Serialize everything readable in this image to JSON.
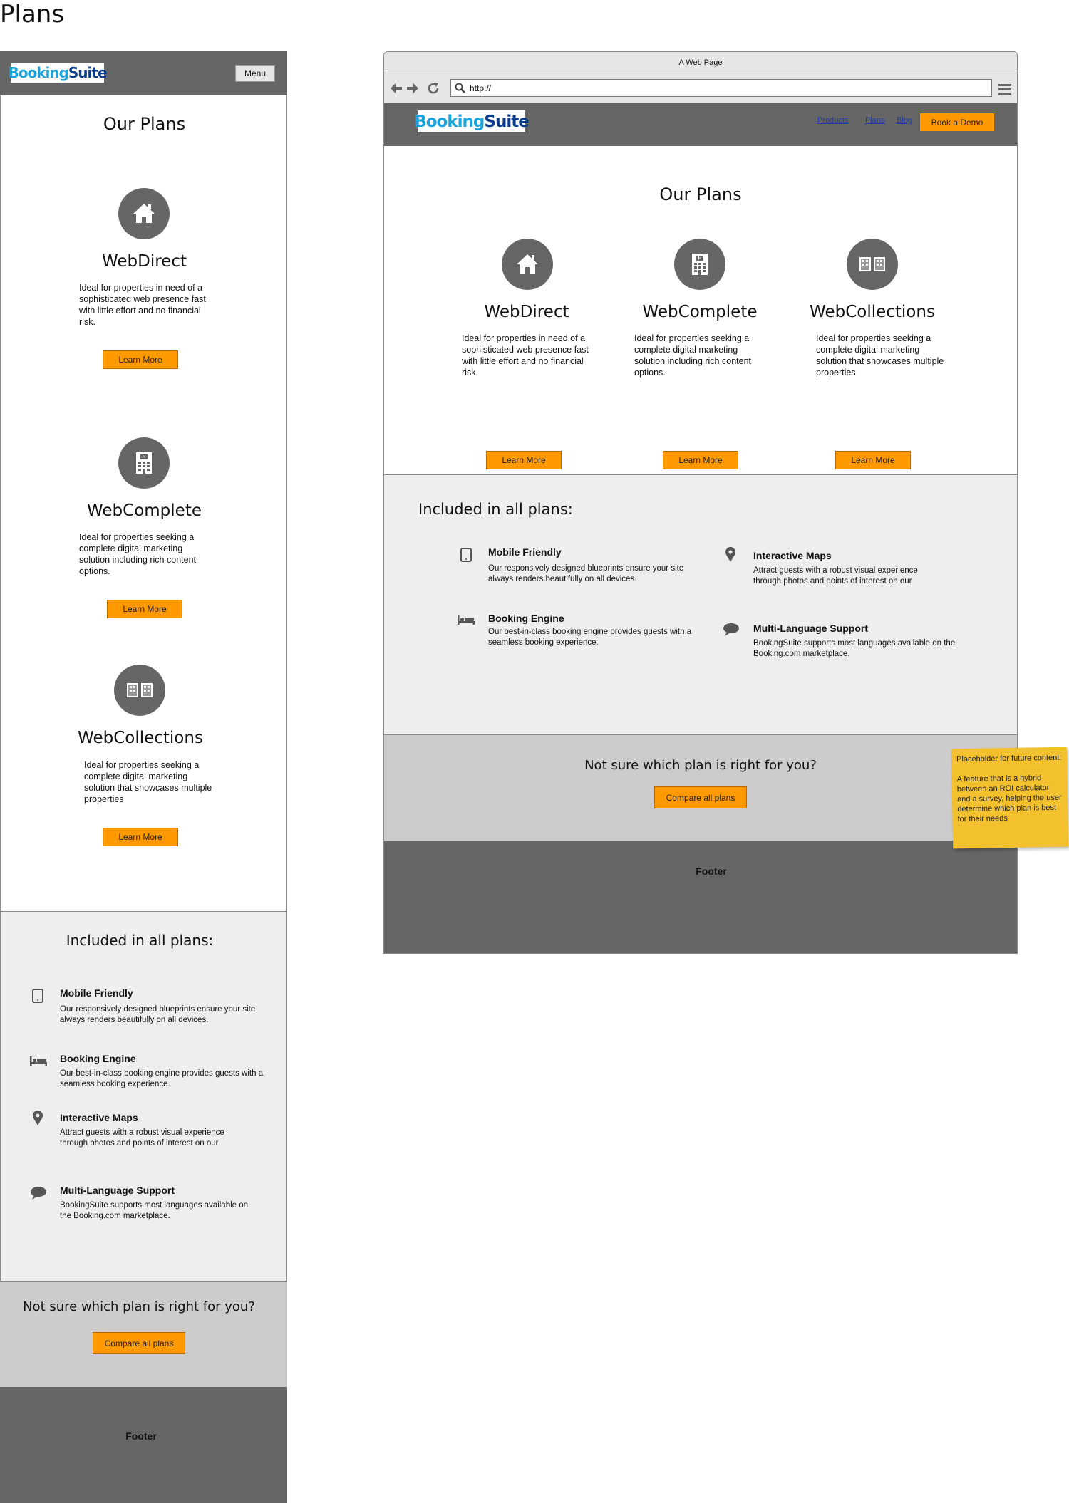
{
  "page": {
    "heading": "Plans"
  },
  "brand": {
    "part1": "Booking",
    "part2": "Suite"
  },
  "mobile": {
    "menu_label": "Menu"
  },
  "browser": {
    "title": "A Web Page",
    "url": "http://",
    "nav": [
      {
        "label": "Products"
      },
      {
        "label": "Plans"
      },
      {
        "label": "Blog"
      }
    ],
    "cta": "Book a Demo"
  },
  "plans_heading": "Our Plans",
  "plans": [
    {
      "title": "WebDirect",
      "desc": "Ideal for properties in need of a sophisticated web presence fast with little effort and no financial risk.",
      "button": "Learn More",
      "icon": "house-icon"
    },
    {
      "title": "WebComplete",
      "desc": "Ideal for properties seeking a complete digital marketing solution including rich content options.",
      "button": "Learn More",
      "icon": "hotel-building-icon"
    },
    {
      "title": "WebCollections",
      "desc": "Ideal for properties seeking a complete digital marketing solution that showcases multiple properties",
      "button": "Learn More",
      "icon": "buildings-icon"
    }
  ],
  "included_heading": "Included in all plans:",
  "features": [
    {
      "title": "Mobile Friendly",
      "desc": "Our responsively designed blueprints ensure your site always renders beautifully on all devices.",
      "icon": "tablet-icon"
    },
    {
      "title": "Booking Engine",
      "desc": "Our best-in-class booking engine provides guests with a seamless booking experience.",
      "icon": "bed-icon"
    },
    {
      "title": "Interactive Maps",
      "desc": "Attract guests with a robust visual experience through photos and points of interest on our",
      "icon": "map-pin-icon"
    },
    {
      "title": "Multi-Language Support",
      "desc": "BookingSuite supports most languages available on the Booking.com marketplace.",
      "icon": "speech-bubble-icon"
    }
  ],
  "compare": {
    "question": "Not sure which plan is right for you?",
    "button": "Compare all plans"
  },
  "footer": {
    "label": "Footer"
  },
  "sticky_note": {
    "line1": "Placeholder for future content:",
    "line2": "A feature that is a hybrid between an ROI calculator and a survey, helping the user determine which plan is best for their needs"
  },
  "colors": {
    "accent": "#ff9900",
    "header_gray": "#666666",
    "light_gray": "#eeeeee",
    "mid_gray": "#cccccc",
    "sticky": "#f3c12e"
  }
}
